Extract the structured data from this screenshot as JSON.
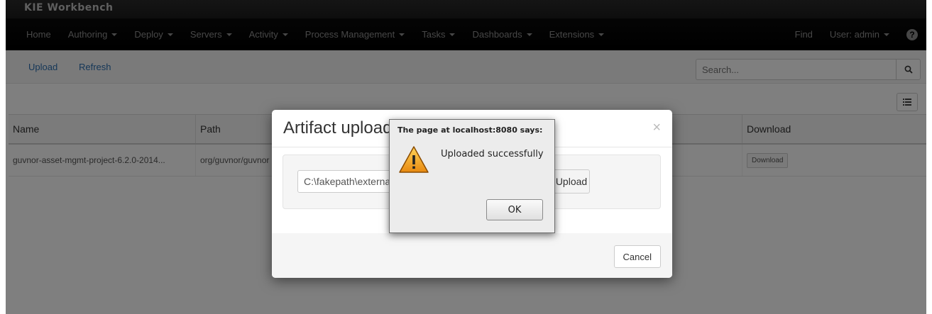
{
  "app": {
    "title": "KIE Workbench"
  },
  "nav": {
    "items": [
      {
        "label": "Home",
        "caret": false
      },
      {
        "label": "Authoring",
        "caret": true
      },
      {
        "label": "Deploy",
        "caret": true
      },
      {
        "label": "Servers",
        "caret": true
      },
      {
        "label": "Activity",
        "caret": true
      },
      {
        "label": "Process Management",
        "caret": true
      },
      {
        "label": "Tasks",
        "caret": true
      },
      {
        "label": "Dashboards",
        "caret": true
      },
      {
        "label": "Extensions",
        "caret": true
      }
    ],
    "find": "Find",
    "user": "User: admin",
    "help_icon": "question-circle-icon"
  },
  "toolbar": {
    "upload_label": "Upload",
    "refresh_label": "Refresh",
    "search_placeholder": "Search...",
    "search_icon": "search-icon",
    "list_icon": "list-view-icon"
  },
  "table": {
    "columns": [
      "Name",
      "Path",
      "Download"
    ],
    "rows": [
      {
        "name": "guvnor-asset-mgmt-project-6.2.0-2014...",
        "path": "org/guvnor/guvnor",
        "download": "Download"
      }
    ]
  },
  "modal": {
    "title": "Artifact upload",
    "file_value": "C:\\fakepath\\external",
    "upload_label": "Upload",
    "cancel_label": "Cancel",
    "close_icon": "close-icon"
  },
  "alert": {
    "title": "The page at localhost:8080 says:",
    "message": "Uploaded successfully",
    "ok_label": "OK",
    "icon": "warning-icon",
    "icon_color": "#f0a020"
  }
}
